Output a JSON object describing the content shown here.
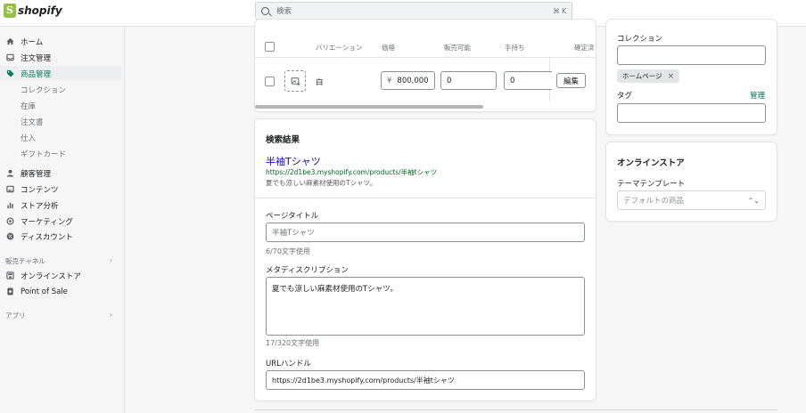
{
  "brand": {
    "name": "shopify"
  },
  "search": {
    "placeholder": "検索",
    "shortcut": "⌘ K"
  },
  "sidebar": {
    "items": [
      {
        "label": "ホーム",
        "icon": "home-icon"
      },
      {
        "label": "注文管理",
        "icon": "inbox-icon"
      },
      {
        "label": "商品管理",
        "icon": "tag-icon",
        "active": true
      }
    ],
    "product_sub": [
      "コレクション",
      "在庫",
      "注文書",
      "仕入",
      "ギフトカード"
    ],
    "items2": [
      {
        "label": "顧客管理",
        "icon": "person-icon"
      },
      {
        "label": "コンテンツ",
        "icon": "image-icon"
      },
      {
        "label": "ストア分析",
        "icon": "bar-chart-icon"
      },
      {
        "label": "マーケティング",
        "icon": "target-icon"
      },
      {
        "label": "ディスカウント",
        "icon": "discount-icon"
      }
    ],
    "sales_channels_label": "販売チャネル",
    "channels": [
      {
        "label": "オンラインストア",
        "icon": "store-icon"
      },
      {
        "label": "Point of Sale",
        "icon": "pos-icon"
      }
    ],
    "apps_label": "アプリ"
  },
  "variants": {
    "headers": [
      "バリエーション",
      "価格",
      "販売可能",
      "手持ち",
      "確定済"
    ],
    "row": {
      "name": "白",
      "currency": "¥",
      "price": "800,000",
      "available": "0",
      "on_hand": "0",
      "edit_label": "編集"
    }
  },
  "seo": {
    "title": "検索結果",
    "preview_title": "半袖Tシャツ",
    "preview_url": "https://2d1be3.myshopify.com/products/半袖tシャツ",
    "preview_desc": "夏でも涼しい麻素材使用のTシャツ。",
    "page_title_label": "ページタイトル",
    "page_title_value": "半袖Tシャツ",
    "page_title_help": "6/70文字使用",
    "meta_label": "メタディスクリプション",
    "meta_value": "夏でも涼しい麻素材使用のTシャツ。",
    "meta_help": "17/320文字使用",
    "url_label": "URLハンドル",
    "url_value": "https://2d1be3.myshopify.com/products/半袖tシャツ"
  },
  "organization": {
    "collection_label": "コレクション",
    "collection_tag": "ホームページ",
    "tags_label": "タグ",
    "manage_label": "管理"
  },
  "online_store": {
    "title": "オンラインストア",
    "template_label": "テーマテンプレート",
    "template_value": "デフォルトの商品"
  },
  "colors": {
    "accent": "#007f5f",
    "brand": "#95bf47"
  }
}
